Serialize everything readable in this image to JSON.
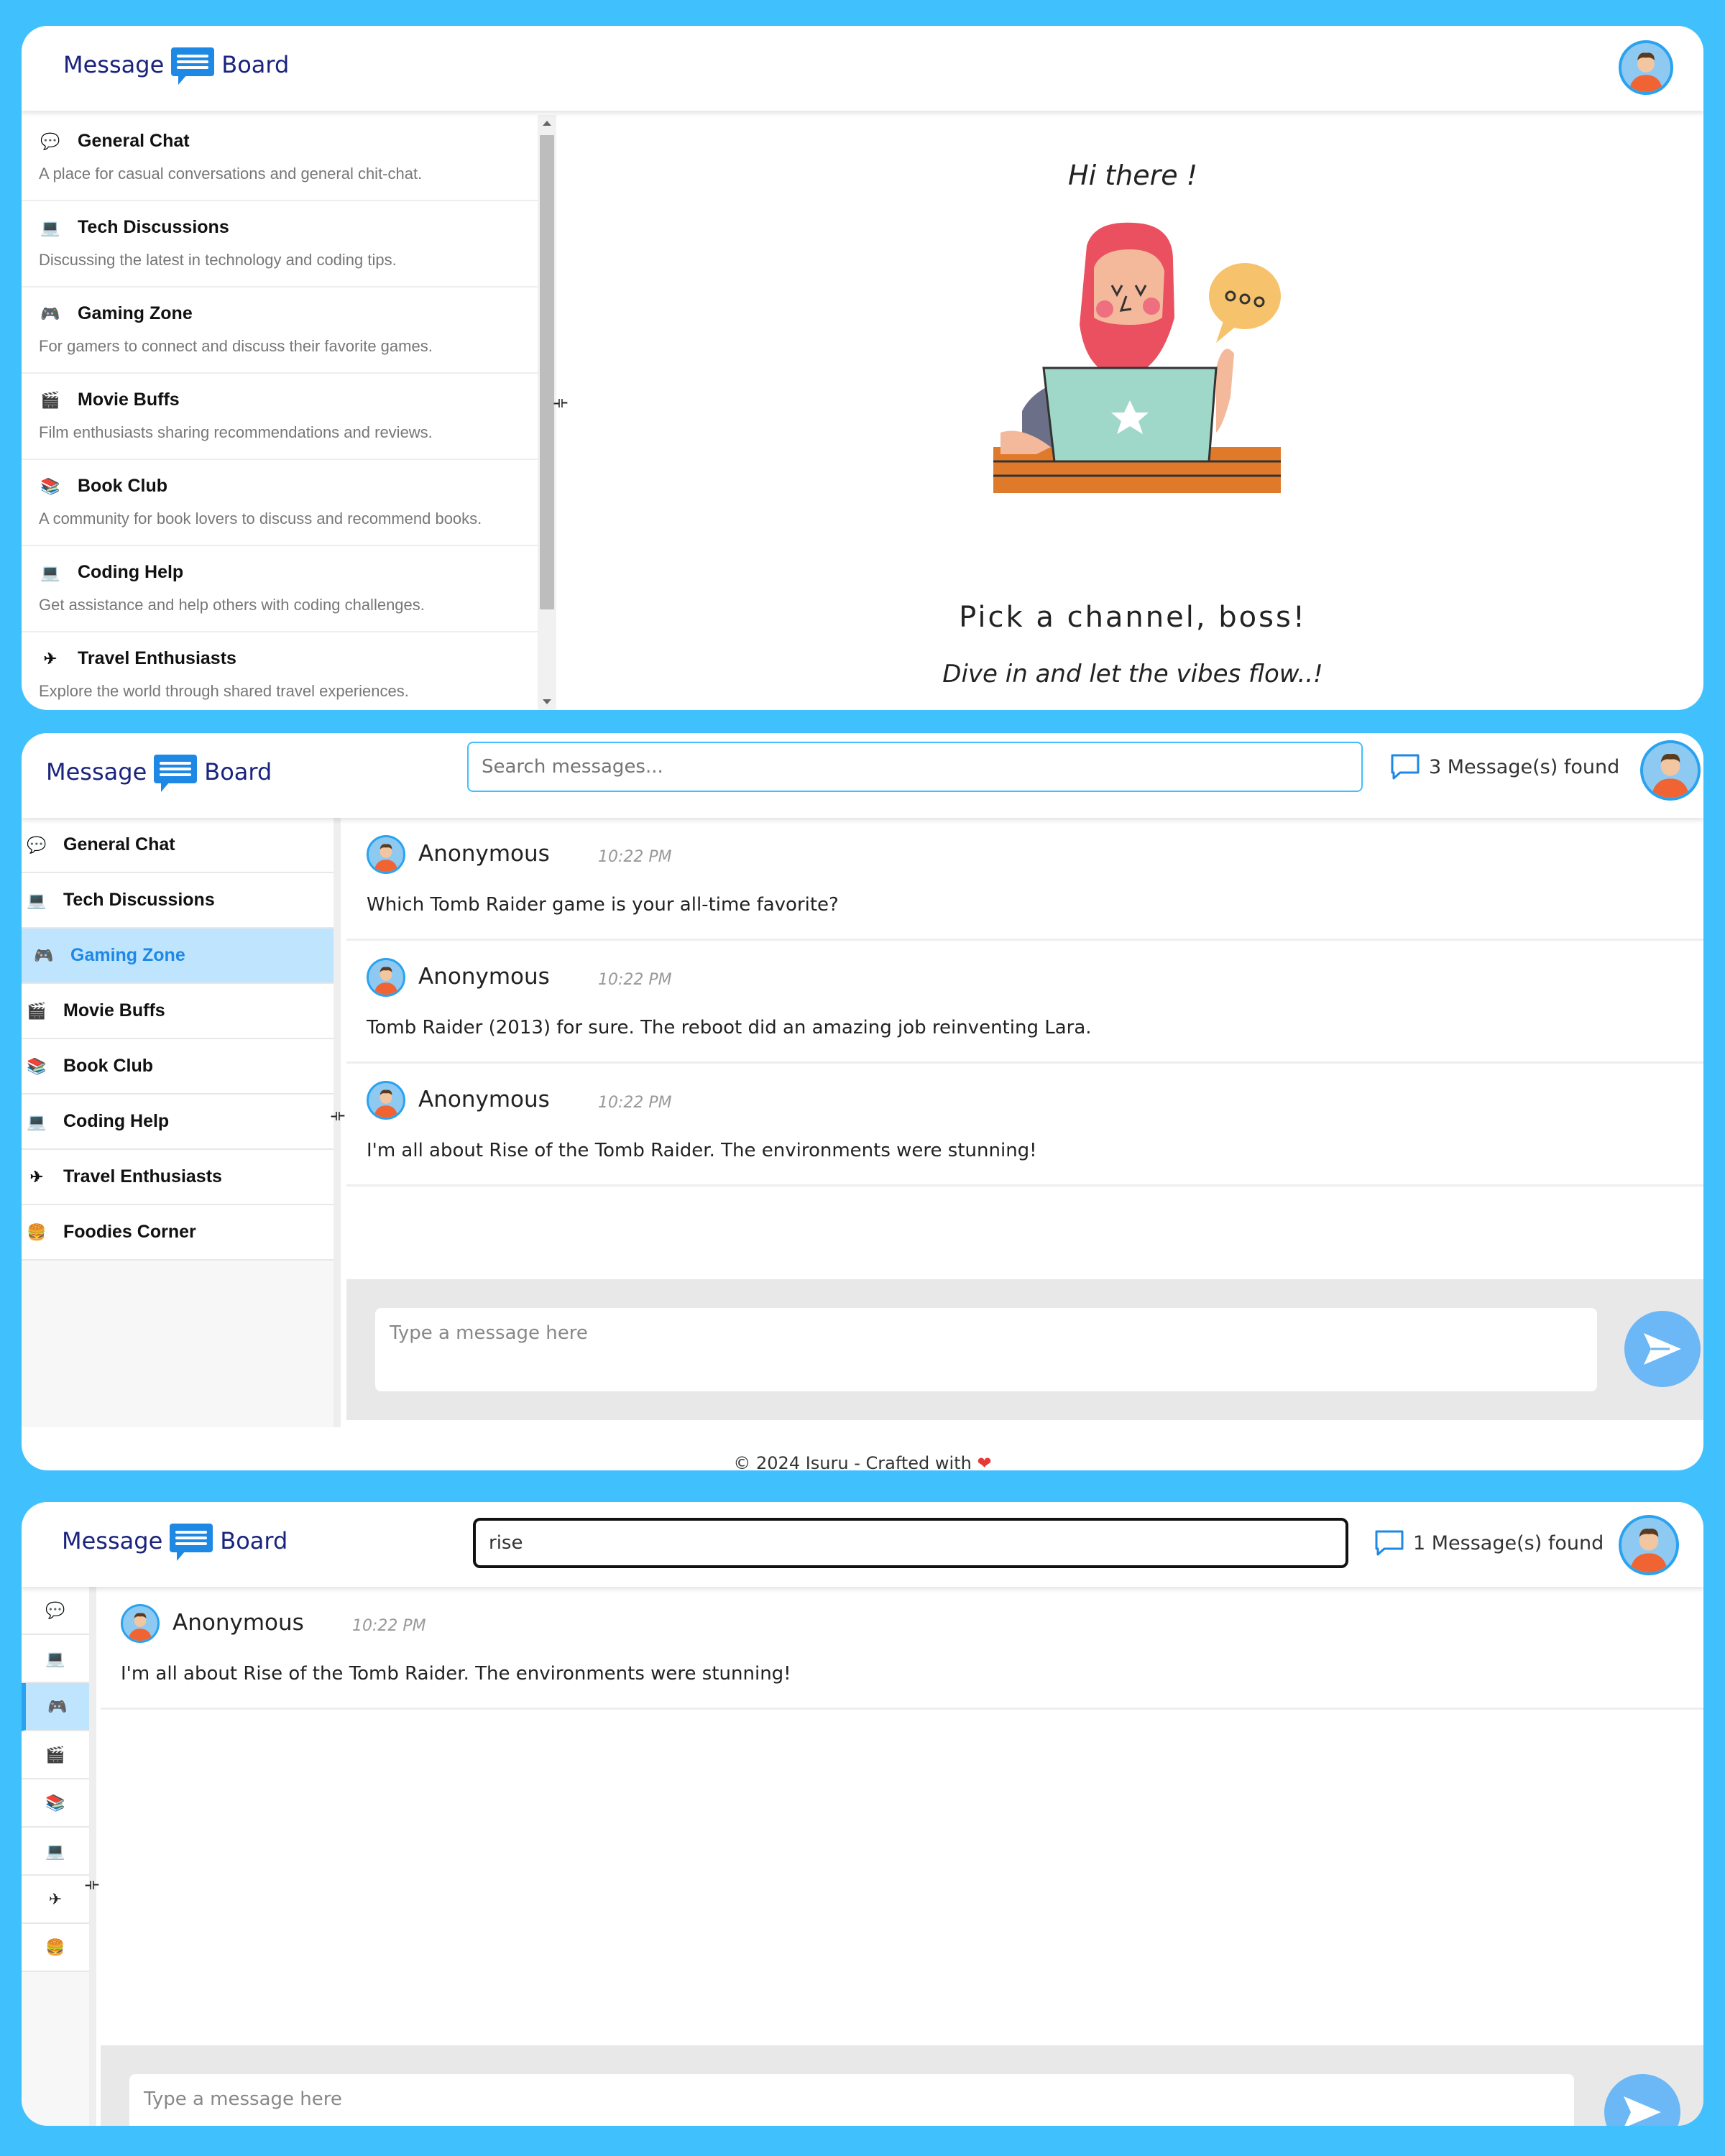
{
  "app": {
    "logo_left": "Message",
    "logo_right": "Board",
    "colors": {
      "accent": "#40c0fc",
      "brand": "#1a237e",
      "selected_bg": "#bfe4fe",
      "logo_icon": "#1e88e5"
    }
  },
  "channels": [
    {
      "name": "General Chat",
      "icon": "speech-bubble-icon",
      "glyph": "💬",
      "description": "A place for casual conversations and general chit-chat."
    },
    {
      "name": "Tech Discussions",
      "icon": "computer-icon",
      "glyph": "💻",
      "description": "Discussing the latest in technology and coding tips."
    },
    {
      "name": "Gaming Zone",
      "icon": "gamepad-icon",
      "glyph": "🎮",
      "description": "For gamers to connect and discuss their favorite games."
    },
    {
      "name": "Movie Buffs",
      "icon": "clapperboard-icon",
      "glyph": "🎬",
      "description": "Film enthusiasts sharing recommendations and reviews."
    },
    {
      "name": "Book Club",
      "icon": "books-icon",
      "glyph": "📚",
      "description": "A community for book lovers to discuss and recommend books."
    },
    {
      "name": "Coding Help",
      "icon": "computer-icon",
      "glyph": "💻",
      "description": "Get assistance and help others with coding challenges."
    },
    {
      "name": "Travel Enthusiasts",
      "icon": "airplane-icon",
      "glyph": "✈",
      "description": "Explore the world through shared travel experiences."
    },
    {
      "name": "Foodies Corner",
      "icon": "burger-icon",
      "glyph": "🍔",
      "description": ""
    }
  ],
  "welcome": {
    "greeting": "Hi there !",
    "heading": "Pick a channel, boss!",
    "subheading": "Dive in and let the vibes flow..!"
  },
  "view2": {
    "search_placeholder": "Search messages...",
    "search_value": "",
    "found": "3 Message(s) found",
    "selected_channel": "Gaming Zone",
    "messages": [
      {
        "author": "Anonymous",
        "time": "10:22 PM",
        "text": "Which Tomb Raider game is your all-time favorite?"
      },
      {
        "author": "Anonymous",
        "time": "10:22 PM",
        "text": "Tomb Raider (2013) for sure. The reboot did an amazing job reinventing Lara."
      },
      {
        "author": "Anonymous",
        "time": "10:22 PM",
        "text": "I'm all about Rise of the Tomb Raider. The environments were stunning!"
      }
    ],
    "compose_placeholder": "Type a message here",
    "footer": "© 2024 Isuru - Crafted with",
    "footer_heart": "❤"
  },
  "view3": {
    "search_value": "rise",
    "found": "1 Message(s) found",
    "messages": [
      {
        "author": "Anonymous",
        "time": "10:22 PM",
        "text": "I'm all about Rise of the Tomb Raider. The environments were stunning!"
      }
    ],
    "compose_placeholder": "Type a message here"
  }
}
